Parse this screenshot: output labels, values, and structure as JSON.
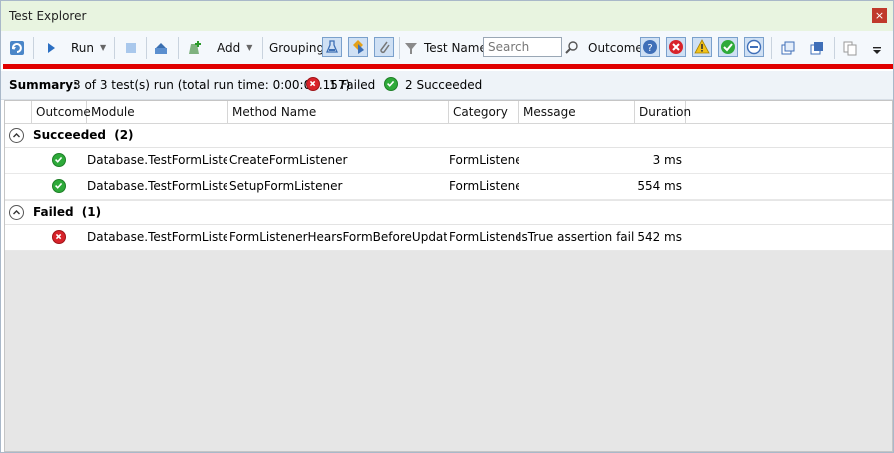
{
  "window": {
    "title": "Test Explorer",
    "close_glyph": "×"
  },
  "toolbar": {
    "run_label": "Run",
    "add_label": "Add",
    "grouping_label": "Grouping",
    "test_name_label": "Test Name",
    "search_placeholder": "Search",
    "outcome_label": "Outcome",
    "icons": [
      "refresh-icon",
      "run-icon",
      "stop-icon",
      "import-icon",
      "add-icon",
      "group-flask-icon",
      "group-category-icon",
      "group-attachment-icon",
      "filter-icon",
      "search-icon",
      "outcome-unknown-icon",
      "outcome-failed-icon",
      "outcome-warning-icon",
      "outcome-passed-icon",
      "outcome-skipped-icon",
      "expand-all-icon",
      "collapse-all-icon",
      "copy-icon",
      "overflow-icon"
    ]
  },
  "summary": {
    "label": "Summary:",
    "text": "3 of 3 test(s) run (total run time: 0:00:01.157)",
    "failed_text": "1 Failed",
    "succeeded_text": "2 Succeeded"
  },
  "columns": [
    "Outcome",
    "Module",
    "Method Name",
    "Category",
    "Message",
    "Duration"
  ],
  "groups": [
    {
      "title": "Succeeded",
      "count": "(2)",
      "rows": [
        {
          "status": "passed",
          "module": "Database.TestFormListener",
          "method": "CreateFormListener",
          "category": "FormListener",
          "message": "",
          "duration": "3 ms"
        },
        {
          "status": "passed",
          "module": "Database.TestFormListener",
          "method": "SetupFormListener",
          "category": "FormListener",
          "message": "",
          "duration": "554 ms"
        }
      ]
    },
    {
      "title": "Failed",
      "count": "(1)",
      "rows": [
        {
          "status": "failed",
          "module": "Database.TestFormListener",
          "method": "FormListenerHearsFormBeforeUpdateEvent",
          "category": "FormListener",
          "message": "IsTrue assertion failed.",
          "duration": "542 ms"
        }
      ]
    }
  ],
  "colors": {
    "accent_red": "#e00000",
    "passed": "#2eaa3a",
    "failed": "#d8232a",
    "title_bar": "#e8f4e0"
  }
}
